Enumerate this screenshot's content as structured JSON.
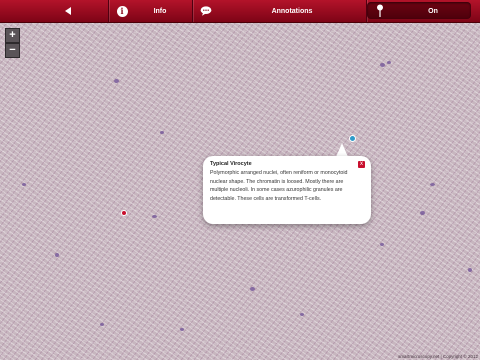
{
  "toolbar": {
    "back_icon": "back-arrow-icon",
    "info_icon": "info-icon",
    "info_label": "Info",
    "annotations_icon": "speech-bubble-icon",
    "annotations_label": "Annotations",
    "pin_icon": "pin-icon",
    "toggle_label": "On",
    "accent_color": "#9e0c22"
  },
  "zoom": {
    "in_label": "+",
    "out_label": "−"
  },
  "annotation": {
    "title": "Typical Virocyte",
    "body": "Polymorphic arranged nuclei, often reniform or monocytoid nuclear shape. The chromatin is loosed. Mostly there are multiple nucleoli. In some cases azurophilic granules are detectable. These cells are transformed T-cells.",
    "close_label": "x"
  },
  "markers": [
    {
      "name": "selected-marker",
      "color": "#2f9bc9"
    },
    {
      "name": "red-marker",
      "color": "#c8102e"
    }
  ],
  "footer": {
    "copyright": "smartmicroscopy.net | Copyright © 2012"
  }
}
